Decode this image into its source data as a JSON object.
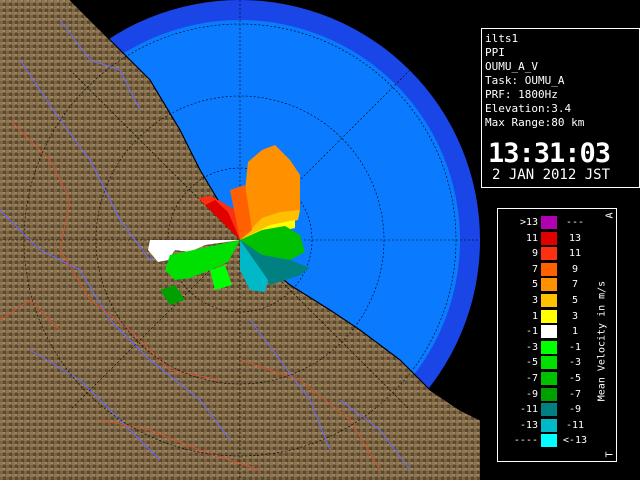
{
  "info": {
    "site": "ilts1",
    "product": "PPI",
    "product_name": "OUMU_A_V",
    "task": "Task: OUMU_A",
    "prf": "PRF: 1800Hz",
    "elevation": "Elevation:3.4",
    "max_range": "Max Range:80 km",
    "time": "13:31:03",
    "date": "2 JAN 2012 JST"
  },
  "legend": {
    "title": "Mean Velocity in m/s",
    "top_mark": "A",
    "bottom_mark": "T",
    "rows": [
      {
        "low": ">13",
        "high": "---",
        "color": "#b000b0"
      },
      {
        "low": "11",
        "high": "13",
        "color": "#e00000"
      },
      {
        "low": "9",
        "high": "11",
        "color": "#ff3010"
      },
      {
        "low": "7",
        "high": "9",
        "color": "#ff6000"
      },
      {
        "low": "5",
        "high": "7",
        "color": "#ff9000"
      },
      {
        "low": "3",
        "high": "5",
        "color": "#ffc000"
      },
      {
        "low": "1",
        "high": "3",
        "color": "#ffff00"
      },
      {
        "low": "-1",
        "high": "1",
        "color": "#ffffff"
      },
      {
        "low": "-3",
        "high": "-1",
        "color": "#00ff00"
      },
      {
        "low": "-5",
        "high": "-3",
        "color": "#00e000"
      },
      {
        "low": "-7",
        "high": "-5",
        "color": "#00c000"
      },
      {
        "low": "-9",
        "high": "-7",
        "color": "#00a000"
      },
      {
        "low": "-11",
        "high": "-9",
        "color": "#008080"
      },
      {
        "low": "-13",
        "high": "-11",
        "color": "#00b8c8"
      },
      {
        "low": "----",
        "high": "<-13",
        "color": "#00ffff"
      }
    ]
  },
  "colors": {
    "sea": "#0a7aff",
    "sea_outer": "#1a46e8",
    "land": "#6e5a3c",
    "river": "#6a6aff",
    "boundary": "#d05030",
    "range_ring": "#000000"
  }
}
